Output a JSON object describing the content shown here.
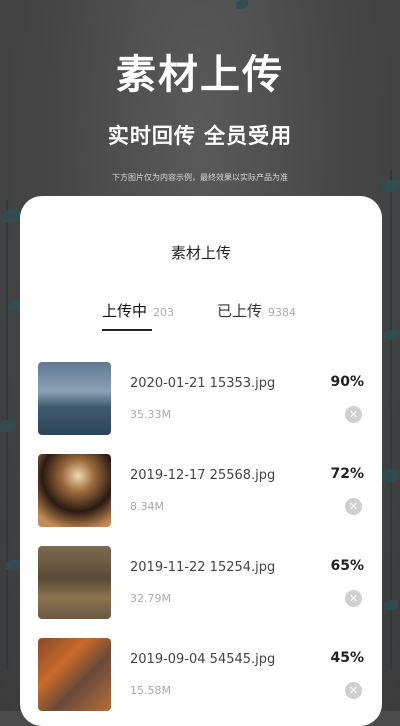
{
  "hero": {
    "title": "素材上传",
    "subtitle": "实时回传 全员受用",
    "note": "下方图片仅为内容示例，最终效果以实际产品为准"
  },
  "card": {
    "title": "素材上传",
    "tabs": [
      {
        "label": "上传中",
        "count": "203",
        "active": true
      },
      {
        "label": "已上传",
        "count": "9384",
        "active": false
      }
    ],
    "items": [
      {
        "filename": "2020-01-21 15353.jpg",
        "size": "35.33M",
        "progress": "90%",
        "progress_value": 0.9
      },
      {
        "filename": "2019-12-17 25568.jpg",
        "size": "8.34M",
        "progress": "72%",
        "progress_value": 0.72
      },
      {
        "filename": "2019-11-22 15254.jpg",
        "size": "32.79M",
        "progress": "65%",
        "progress_value": 0.65
      },
      {
        "filename": "2019-09-04 54545.jpg",
        "size": "15.58M",
        "progress": "45%",
        "progress_value": 0.45
      }
    ]
  },
  "colors": {
    "background": "#4b4b4b",
    "card": "#ffffff",
    "text": "#222222",
    "muted": "#aaaaaa"
  },
  "icons": {
    "cancel": "close-circle-icon"
  }
}
